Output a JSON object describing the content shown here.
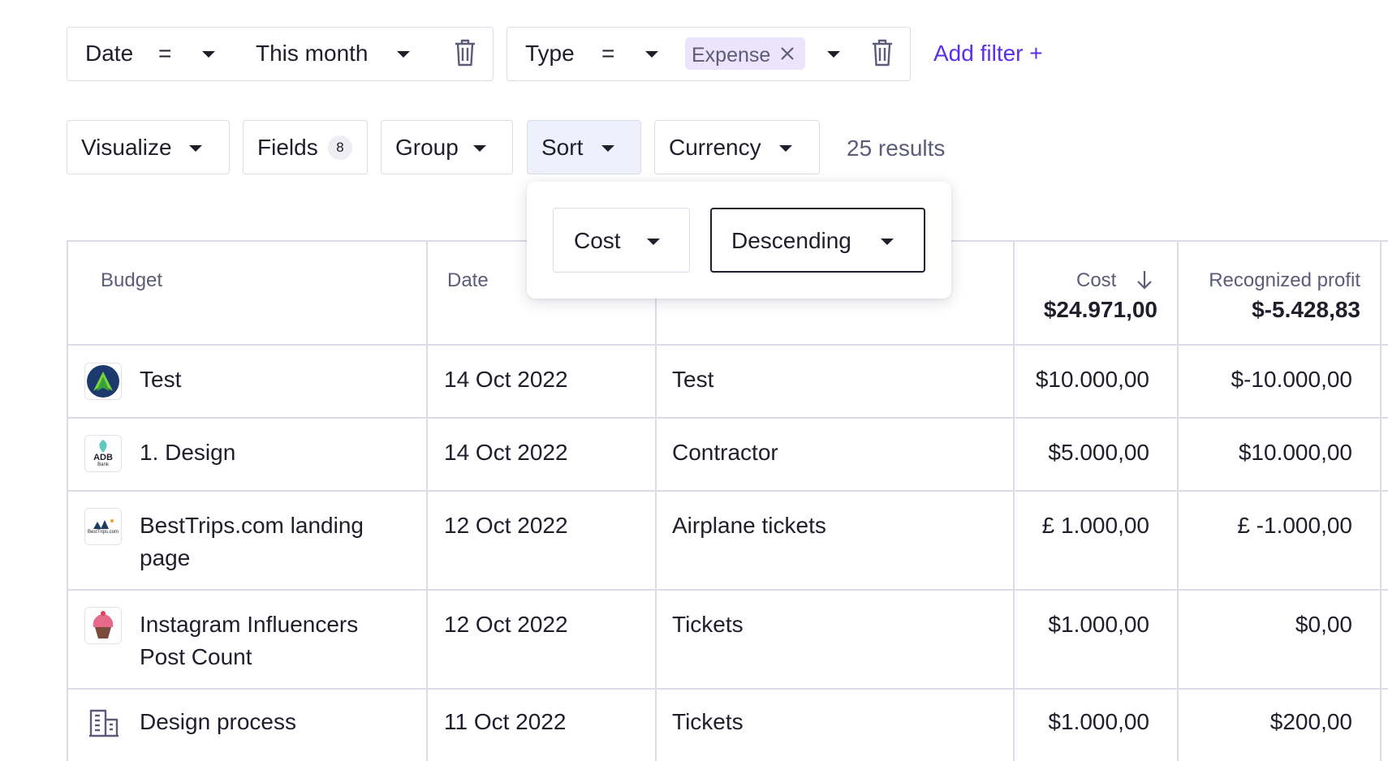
{
  "filters": [
    {
      "field": "Date",
      "operator": "=",
      "value": "This month"
    },
    {
      "field": "Type",
      "operator": "=",
      "chip": "Expense"
    }
  ],
  "add_filter_label": "Add filter +",
  "toolbar": {
    "visualize": "Visualize",
    "fields": "Fields",
    "fields_count": "8",
    "group": "Group",
    "sort": "Sort",
    "currency": "Currency",
    "results": "25 results"
  },
  "sort_popover": {
    "field": "Cost",
    "direction": "Descending"
  },
  "table": {
    "columns": {
      "budget": "Budget",
      "date": "Date",
      "cost": "Cost",
      "cost_total": "$24.971,00",
      "profit": "Recognized profit",
      "profit_total": "$-5.428,83"
    },
    "rows": [
      {
        "budget": "Test",
        "date": "14 Oct 2022",
        "type": "Test",
        "cost": "$10.000,00",
        "profit": "$-10.000,00",
        "logo": "tree-logo-icon"
      },
      {
        "budget": "1. Design",
        "date": "14 Oct 2022",
        "type": "Contractor",
        "cost": "$5.000,00",
        "profit": "$10.000,00",
        "logo": "adb-bank-logo-icon",
        "logo_text": "ADB",
        "logo_sub": "Bank"
      },
      {
        "budget_l1": "BestTrips.com landing",
        "budget_l2": "page",
        "date": "12 Oct 2022",
        "type": "Airplane tickets",
        "cost": "£ 1.000,00",
        "profit": "£ -1.000,00",
        "logo": "besttrips-logo-icon",
        "logo_text": "BestTrips.com"
      },
      {
        "budget_l1": "Instagram Influencers",
        "budget_l2": "Post Count",
        "date": "12 Oct 2022",
        "type": "Tickets",
        "cost": "$1.000,00",
        "profit": "$0,00",
        "logo": "cupcake-logo-icon"
      },
      {
        "budget": "Design process",
        "date": "11 Oct 2022",
        "type": "Tickets",
        "cost": "$1.000,00",
        "profit": "$200,00",
        "logo": "building-icon"
      }
    ]
  },
  "colors": {
    "accent": "#5b2ee8",
    "chip_bg": "#ebe4fb",
    "border": "#dcdce6",
    "muted": "#5c5c7a"
  }
}
